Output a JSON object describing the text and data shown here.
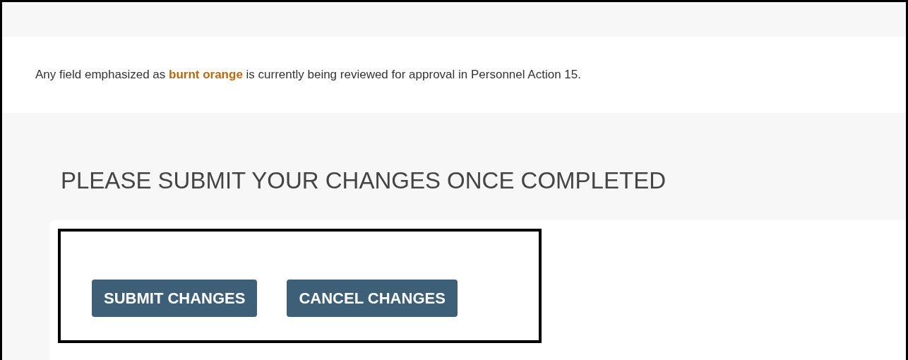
{
  "notice": {
    "text": "Any field emphasized as **burnt orange** is currently being reviewed for approval in Personnel Action 15."
  },
  "heading": "PLEASE SUBMIT YOUR CHANGES ONCE COMPLETED",
  "buttons": [
    {
      "label": "SUBMIT CHANGES"
    },
    {
      "label": "CANCEL CHANGES"
    }
  ]
}
